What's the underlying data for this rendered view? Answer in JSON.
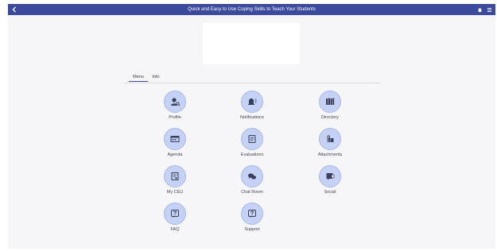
{
  "header": {
    "title": "Quick and Easy to Use Coping Skills to Teach Your Students",
    "colors": {
      "bar": "#3b4a9c",
      "text": "#ffffff"
    },
    "icons": {
      "back": "chevron-left-icon",
      "home": "home-icon",
      "menu": "hamburger-menu-icon"
    }
  },
  "tabs": [
    {
      "label": "Menu",
      "active": true
    },
    {
      "label": "Info",
      "active": false
    }
  ],
  "menu": {
    "accent_color": "#c5d2f5",
    "items": [
      {
        "label": "Profile",
        "icon": "profile-icon"
      },
      {
        "label": "Notifications",
        "icon": "notifications-icon"
      },
      {
        "label": "Directory",
        "icon": "directory-icon"
      },
      {
        "label": "Agenda",
        "icon": "agenda-icon"
      },
      {
        "label": "Evaluations",
        "icon": "evaluations-icon"
      },
      {
        "label": "Attachments",
        "icon": "attachments-icon"
      },
      {
        "label": "My CEU",
        "icon": "certificate-icon"
      },
      {
        "label": "Chat Room",
        "icon": "chat-icon"
      },
      {
        "label": "Social",
        "icon": "social-icon"
      },
      {
        "label": "FAQ",
        "icon": "question-icon"
      },
      {
        "label": "Support",
        "icon": "support-icon"
      }
    ]
  }
}
